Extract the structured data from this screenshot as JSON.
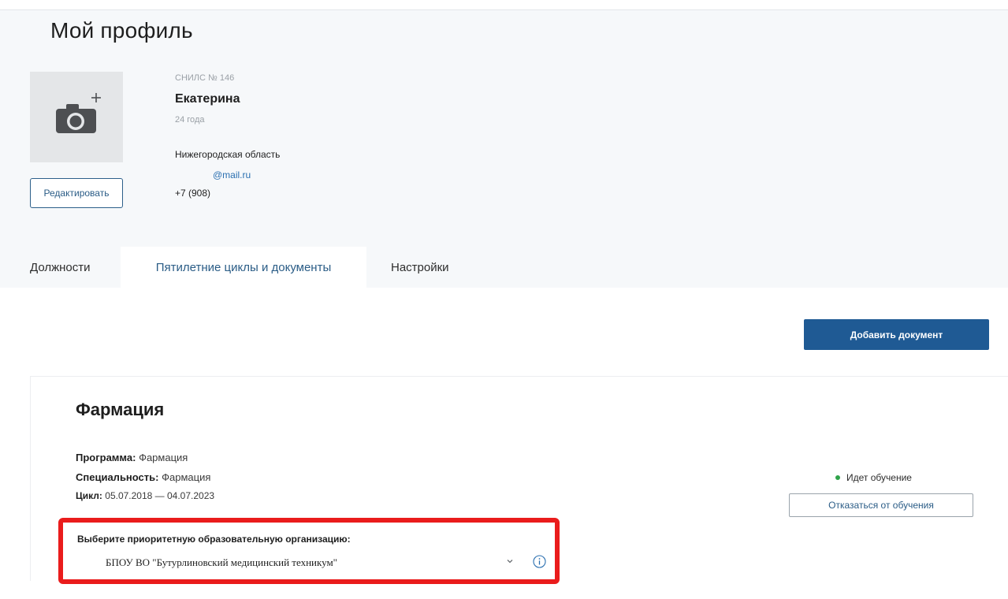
{
  "page": {
    "title": "Мой профиль"
  },
  "profile": {
    "snils": "СНИЛС № 146",
    "name": "Екатерина",
    "age": "24 года",
    "region": "Нижегородская область",
    "email": "@mail.ru",
    "phone": "+7 (908)",
    "edit_label": "Редактировать",
    "avatar_icon": "camera-plus-icon"
  },
  "tabs": [
    {
      "label": "Должности",
      "active": false
    },
    {
      "label": "Пятилетние циклы и документы",
      "active": true
    },
    {
      "label": "Настройки",
      "active": false
    }
  ],
  "actions": {
    "add_document_label": "Добавить документ"
  },
  "document": {
    "title": "Фармация",
    "program_label": "Программа:",
    "program_value": "Фармация",
    "specialty_label": "Специальность:",
    "specialty_value": "Фармация",
    "cycle_label": "Цикл:",
    "cycle_value": "05.07.2018 — 04.07.2023",
    "status": "Идет обучение",
    "decline_label": "Отказаться от обучения",
    "org_prompt": "Выберите приоритетную образовательную организацию:",
    "org_selected": "БПОУ ВО \"Бутурлиновский медицинский техникум\""
  },
  "colors": {
    "primary": "#1f5a94",
    "link": "#2a6fb0",
    "status_green": "#2fa34a",
    "highlight_red": "#ea1c1c"
  }
}
